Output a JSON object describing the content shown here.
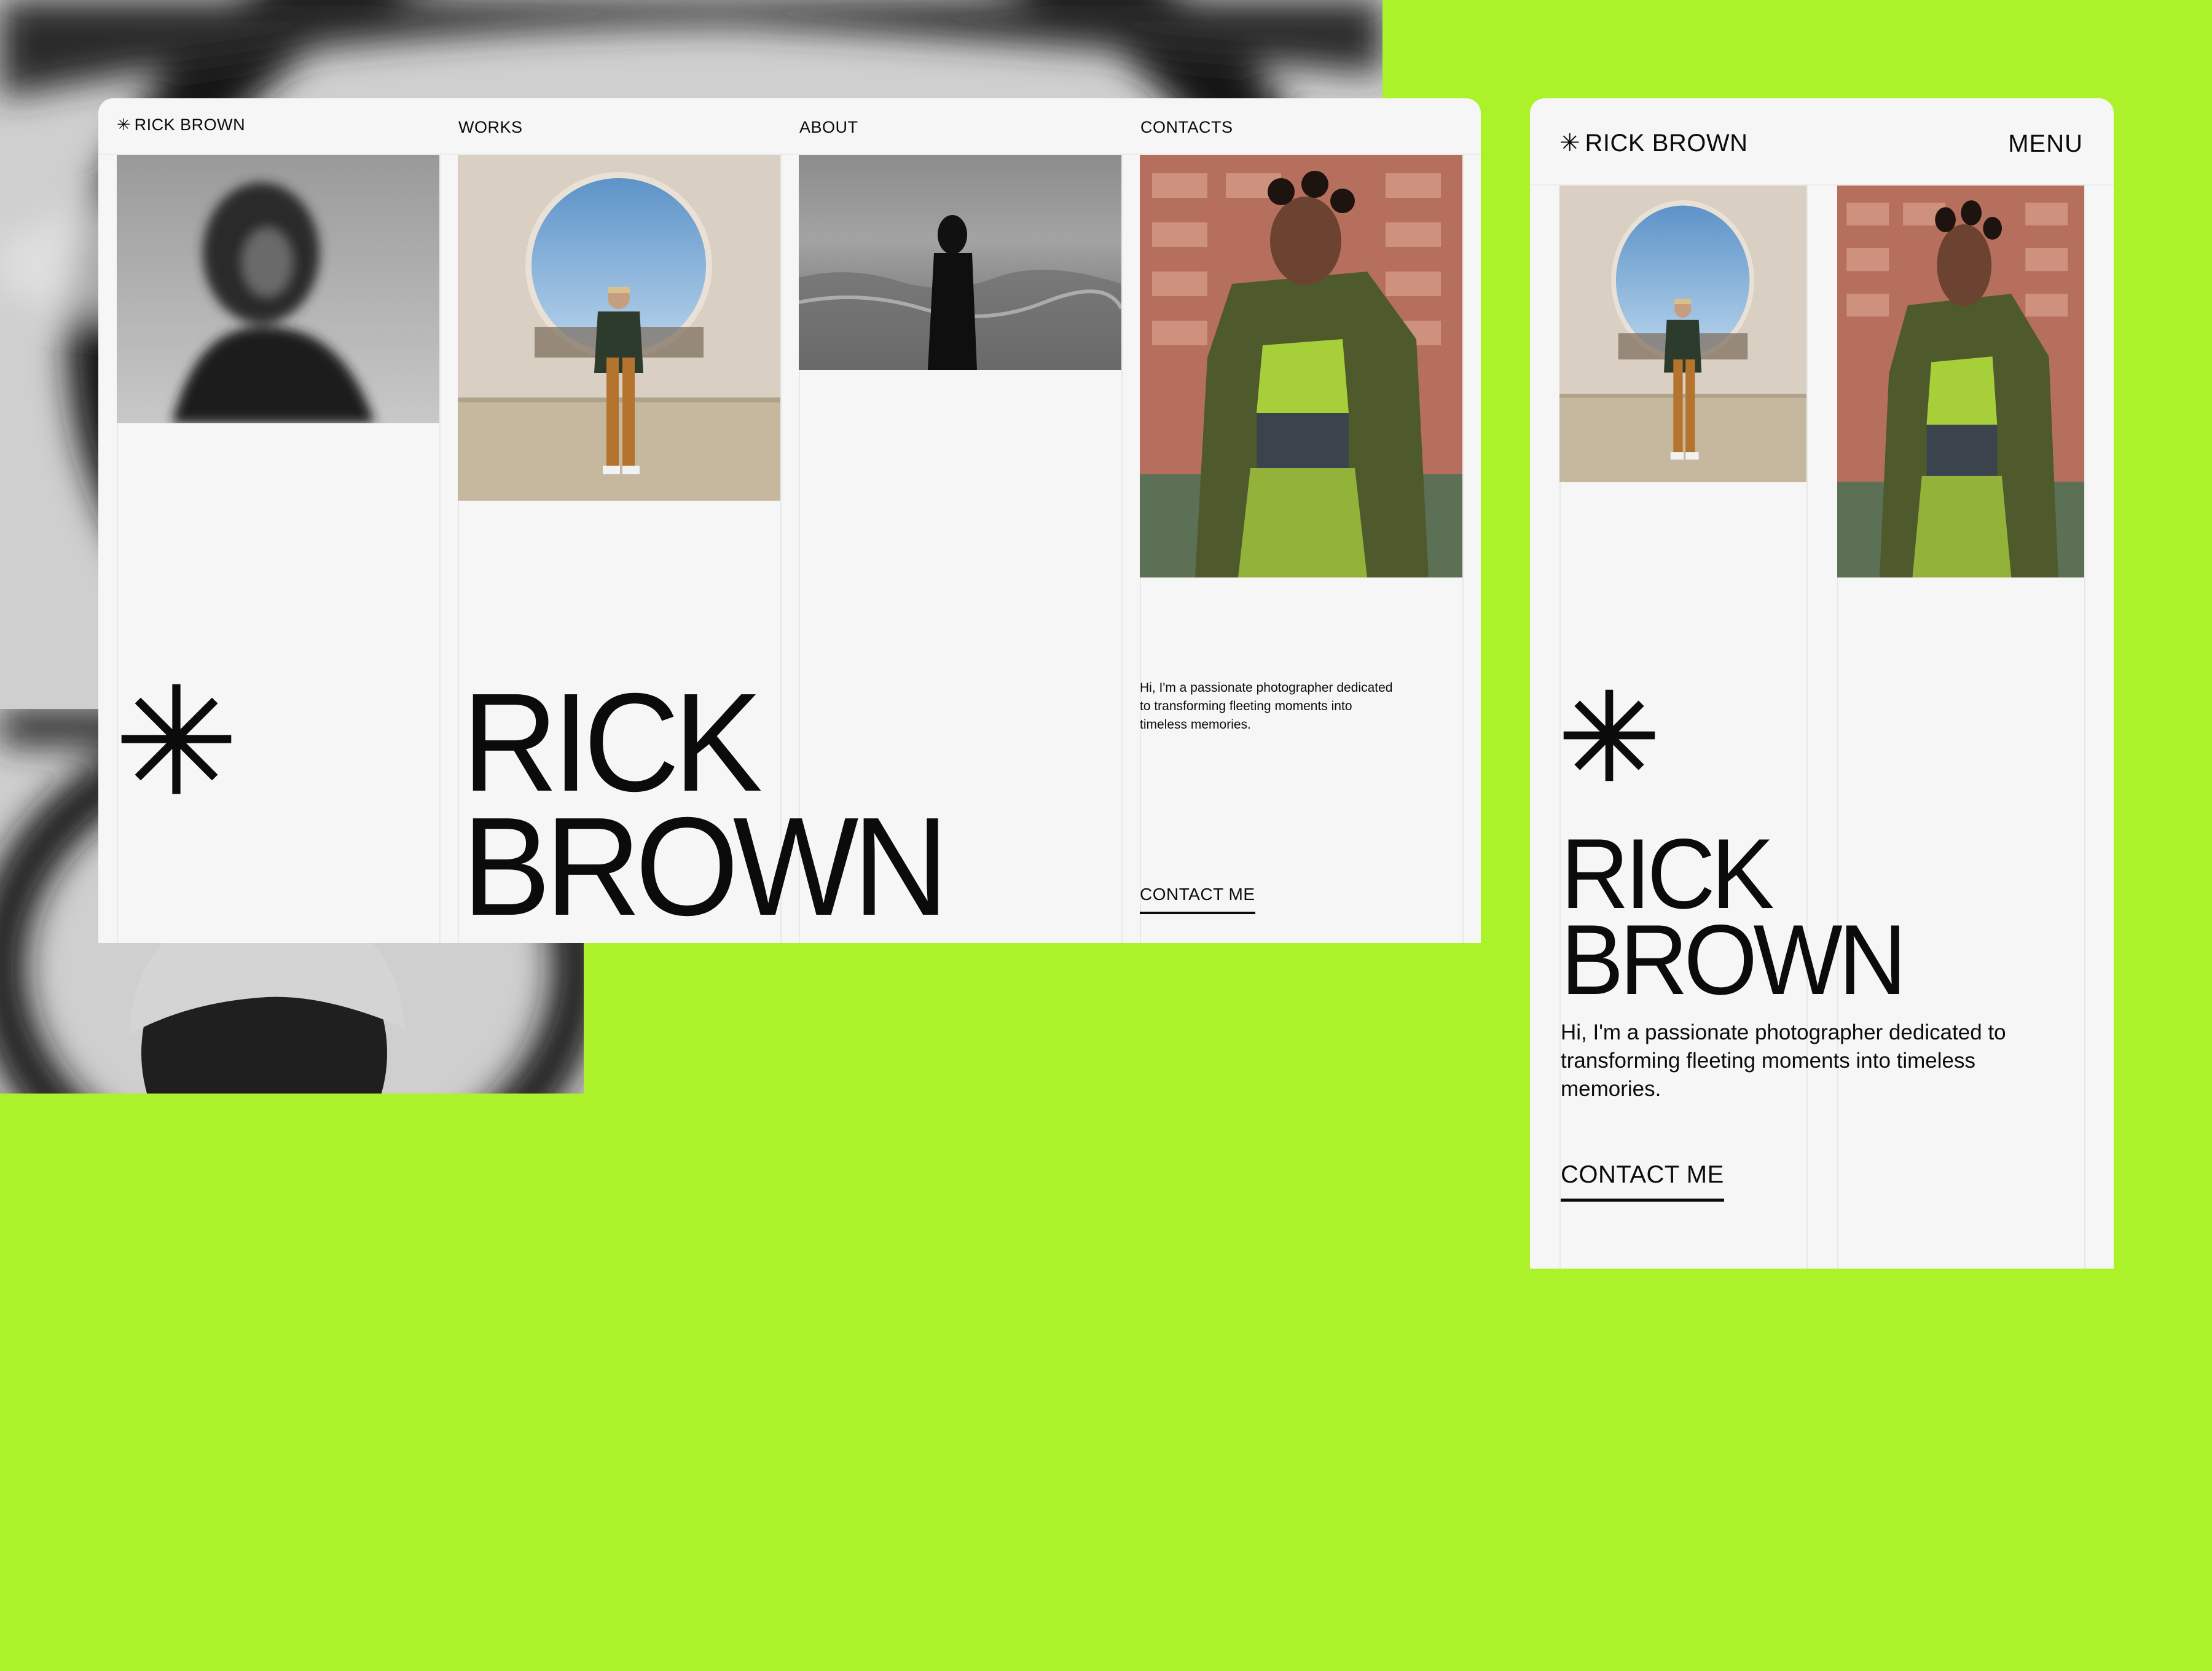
{
  "desktop": {
    "nav": {
      "logo_star": "✳",
      "logo_text": "RICK BROWN",
      "works": "WORKS",
      "about": "ABOUT",
      "contacts": "CONTACTS"
    },
    "hero": {
      "line1": "RICK",
      "line2": "BROWN",
      "intro": "Hi, I'm a passionate photographer dedicated to transforming fleeting moments into timeless memories.",
      "cta": "CONTACT ME"
    }
  },
  "mobile": {
    "header": {
      "logo_star": "✳",
      "logo_text": "RICK BROWN",
      "menu": "MENU"
    },
    "hero": {
      "line1": "RICK",
      "line2": "BROWN",
      "intro": "Hi, I'm a passionate photographer dedicated to transforming fleeting moments into timeless memories.",
      "cta": "CONTACT ME"
    }
  },
  "colors": {
    "background": "#acf22a",
    "surface": "#f6f6f6",
    "ink": "#0b0b0b",
    "divider": "#e8e8e8"
  },
  "icons": [
    "asterisk-icon"
  ]
}
